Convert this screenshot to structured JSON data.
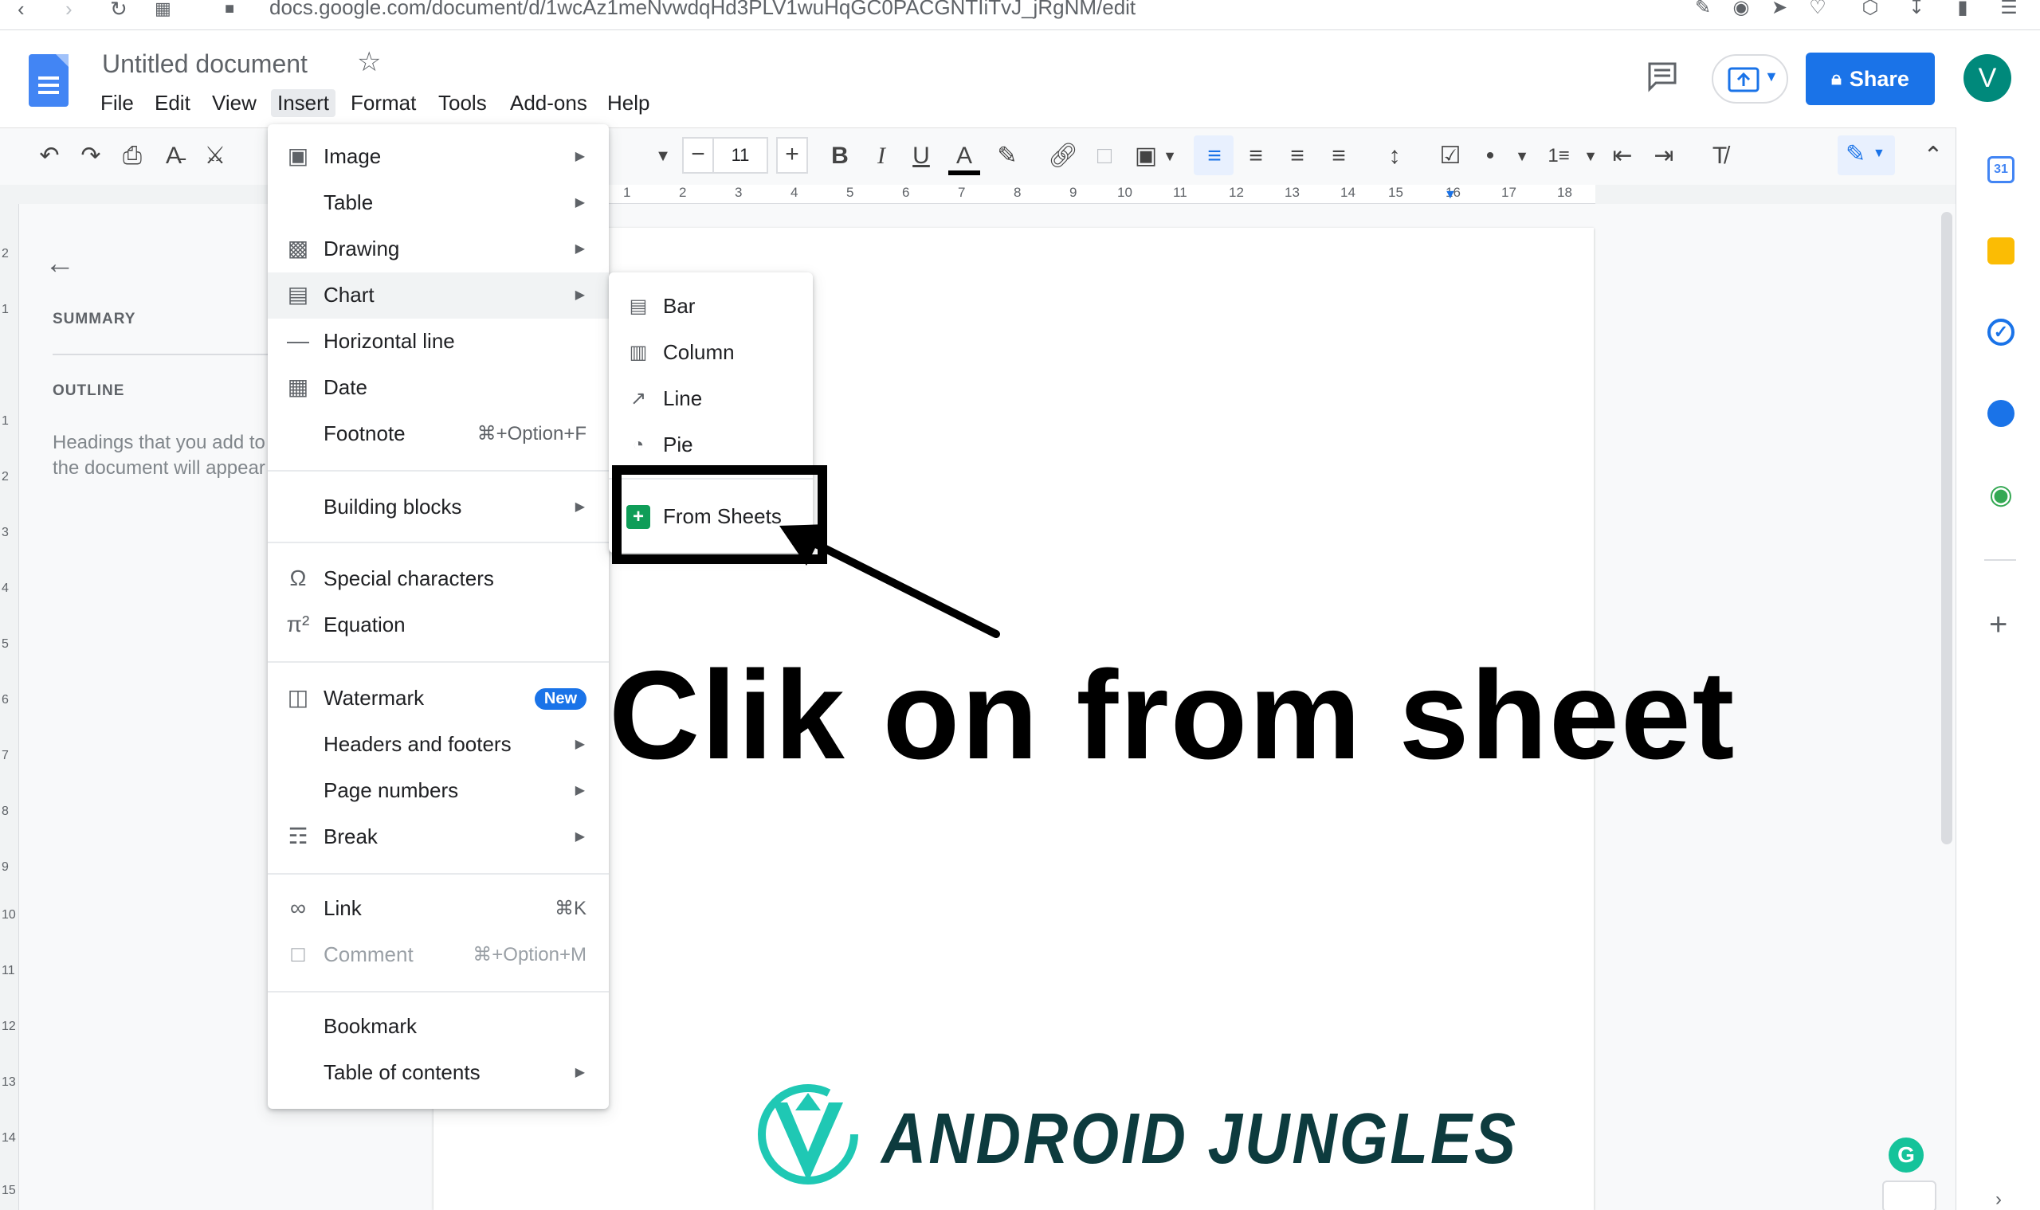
{
  "browser": {
    "url": "docs.google.com/document/d/1wcAz1meNvwdqHd3PLV1wuHqGC0PACGNTIiTvJ_jRgNM/edit"
  },
  "header": {
    "title": "Untitled document",
    "menus": [
      "File",
      "Edit",
      "View",
      "Insert",
      "Format",
      "Tools",
      "Add-ons",
      "Help"
    ],
    "share_label": "Share",
    "avatar_letter": "V"
  },
  "toolbar": {
    "font_size": "11"
  },
  "ruler": {
    "h_ticks": [
      "1",
      "2",
      "3",
      "4",
      "5",
      "6",
      "7",
      "8",
      "9",
      "10",
      "11",
      "12",
      "13",
      "14",
      "15",
      "16",
      "17",
      "18"
    ],
    "v_ticks": [
      "2",
      "1",
      "1",
      "2",
      "3",
      "4",
      "5",
      "6",
      "7",
      "8",
      "9",
      "10",
      "11",
      "12",
      "13",
      "14",
      "15"
    ]
  },
  "side_panel": {
    "summary": "SUMMARY",
    "outline": "OUTLINE",
    "outline_hint": "Headings that you add to the document will appear here."
  },
  "insert_menu": {
    "items": [
      {
        "label": "Image",
        "icon": "image-icon"
      },
      {
        "label": "Table"
      },
      {
        "label": "Drawing",
        "icon": "drawing-icon"
      },
      {
        "label": "Chart",
        "icon": "chart-icon"
      },
      {
        "label": "Horizontal line",
        "icon": "horizontal-line-icon"
      },
      {
        "label": "Date",
        "icon": "calendar-icon"
      },
      {
        "label": "Footnote",
        "shortcut": "⌘+Option+F"
      },
      {
        "label": "Building blocks"
      },
      {
        "label": "Special characters",
        "icon": "omega-icon"
      },
      {
        "label": "Equation",
        "icon": "pi-icon"
      },
      {
        "label": "Watermark",
        "icon": "watermark-icon",
        "badge": "New"
      },
      {
        "label": "Headers and footers"
      },
      {
        "label": "Page numbers"
      },
      {
        "label": "Break",
        "icon": "break-icon"
      },
      {
        "label": "Link",
        "icon": "link-icon",
        "shortcut": "⌘K"
      },
      {
        "label": "Comment",
        "icon": "comment-icon",
        "shortcut": "⌘+Option+M"
      },
      {
        "label": "Bookmark"
      },
      {
        "label": "Table of contents"
      }
    ]
  },
  "chart_menu": {
    "items": [
      {
        "label": "Bar",
        "icon": "bar-chart-icon"
      },
      {
        "label": "Column",
        "icon": "column-chart-icon"
      },
      {
        "label": "Line",
        "icon": "line-chart-icon"
      },
      {
        "label": "Pie",
        "icon": "pie-chart-icon"
      },
      {
        "label": "From Sheets",
        "icon": "sheets-icon"
      }
    ]
  },
  "annotation": {
    "text": "Clik on from sheet"
  },
  "watermark": {
    "logo_text": "ANDROID JUNGLES"
  },
  "colors": {
    "accent": "#1a73e8",
    "docs_blue": "#4285f4",
    "sheets_green": "#0f9d58",
    "logo_teal": "#1fc8b4"
  }
}
